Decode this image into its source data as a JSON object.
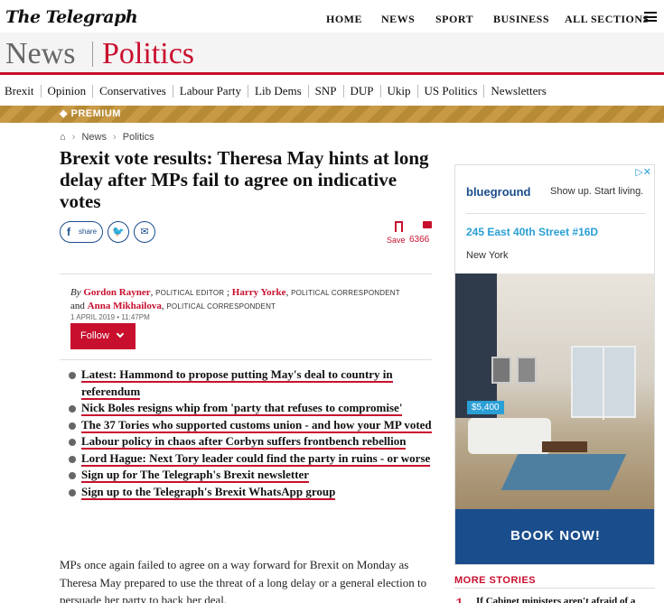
{
  "header": {
    "logo": "The Telegraph",
    "nav": [
      "HOME",
      "NEWS",
      "SPORT",
      "BUSINESS",
      "ALL SECTIONS"
    ]
  },
  "section": {
    "primary": "News",
    "secondary": "Politics"
  },
  "subnav": [
    "Brexit",
    "Opinion",
    "Conservatives",
    "Labour Party",
    "Lib Dems",
    "SNP",
    "DUP",
    "Ukip",
    "US Politics",
    "Newsletters"
  ],
  "premium": "◆ PREMIUM",
  "breadcrumb": {
    "home_icon": "home-icon",
    "items": [
      "News",
      "Politics"
    ]
  },
  "article": {
    "headline": "Brexit vote results: Theresa May hints at long delay after MPs fail to agree on indicative votes",
    "share": {
      "share_label": "share"
    },
    "save_label": "Save",
    "comment_count": "6366",
    "byline": {
      "by": "By",
      "authors": [
        {
          "name": "Gordon Rayner",
          "role": "POLITICAL EDITOR"
        },
        {
          "name": "Harry Yorke",
          "role": "POLITICAL CORRESPONDENT"
        },
        {
          "name": "Anna Mikhailova",
          "role": "POLITICAL CORRESPONDENT"
        }
      ],
      "and": "and",
      "separator": ";",
      "comma": ","
    },
    "date": "1 APRIL 2019 • 11:47PM",
    "follow_label": "Follow",
    "related": [
      "Latest: Hammond to propose putting May's deal to country in referendum",
      "Nick Boles resigns whip from 'party that refuses to compromise'",
      "The 37 Tories who supported customs union - and how your MP voted",
      "Labour policy in chaos after Corbyn suffers frontbench rebellion",
      "Lord Hague: Next Tory leader could find the party in ruins - or worse",
      "Sign up for The Telegraph's Brexit newsletter",
      "Sign up to the Telegraph's Brexit WhatsApp group"
    ],
    "body": "MPs once again failed to agree on a way forward for Brexit on Monday as Theresa May prepared to use the threat of a long delay or a general election to persuade her party to back her deal."
  },
  "ad": {
    "brand": "blueground",
    "tagline": "Show up. Start living.",
    "address": "245 East 40th Street #16D",
    "city": "New York",
    "price": "$5,400",
    "cta": "BOOK NOW!"
  },
  "more_stories": {
    "title": "MORE STORIES",
    "items": [
      {
        "num": "1",
        "title": "If Cabinet ministers aren't afraid of a"
      }
    ]
  },
  "colors": {
    "accent": "#c8102e",
    "link_blue": "#1a4d8c",
    "premium_gold": "#b78a36"
  }
}
